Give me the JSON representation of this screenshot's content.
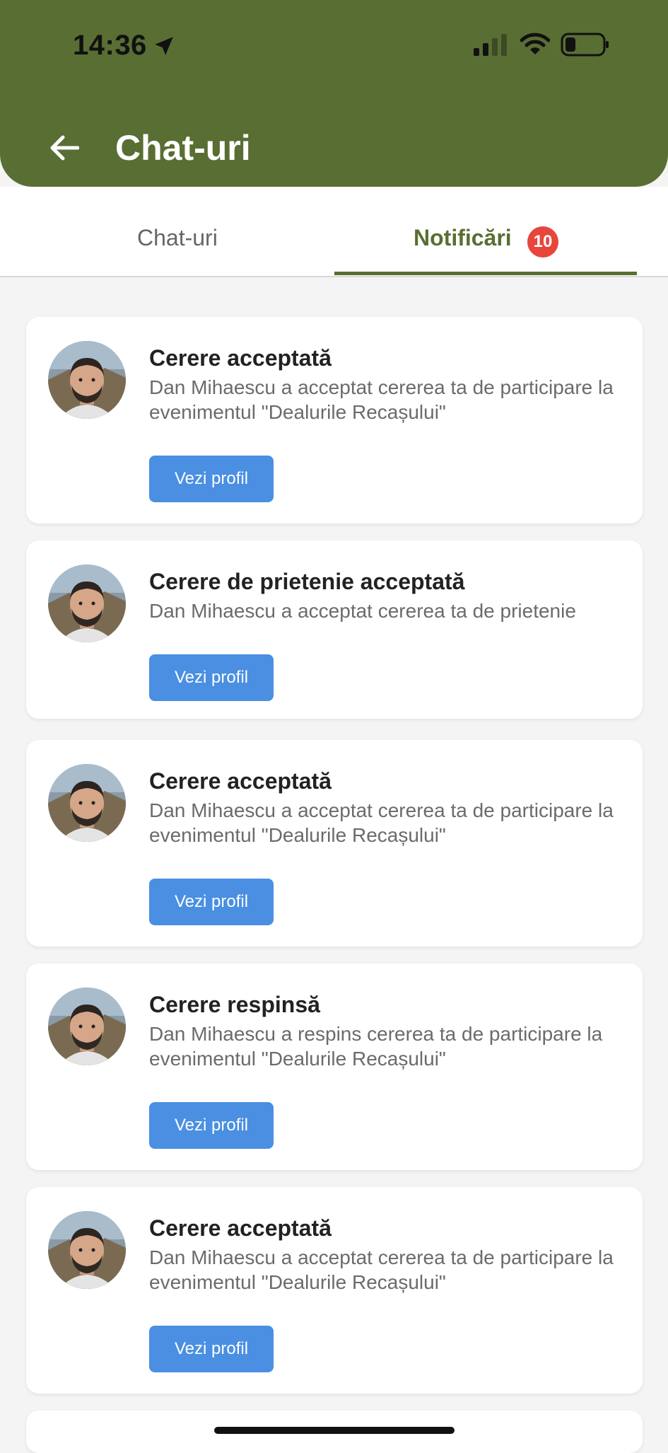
{
  "status_bar": {
    "time": "14:36"
  },
  "header": {
    "title": "Chat-uri"
  },
  "tabs": {
    "chats": "Chat-uri",
    "notifications": "Notificări",
    "notifications_badge": "10"
  },
  "colors": {
    "header": "#596e33",
    "button": "#4a8fe2",
    "badge": "#e8453c"
  },
  "notifications": [
    {
      "title": "Cerere acceptată",
      "message": "Dan Mihaescu a acceptat cererea ta de participare la evenimentul \"Dealurile Recașului\"",
      "button": "Vezi profil"
    },
    {
      "title": "Cerere de prietenie acceptată",
      "message": "Dan Mihaescu a acceptat cererea ta de prietenie",
      "button": "Vezi profil"
    },
    {
      "title": "Cerere acceptată",
      "message": "Dan Mihaescu a acceptat cererea ta de participare la evenimentul \"Dealurile Recașului\"",
      "button": "Vezi profil"
    },
    {
      "title": "Cerere respinsă",
      "message": "Dan Mihaescu a respins cererea ta de participare la evenimentul \"Dealurile Recașului\"",
      "button": "Vezi profil"
    },
    {
      "title": "Cerere acceptată",
      "message": "Dan Mihaescu a acceptat cererea ta de participare la evenimentul \"Dealurile Recașului\"",
      "button": "Vezi profil"
    }
  ]
}
